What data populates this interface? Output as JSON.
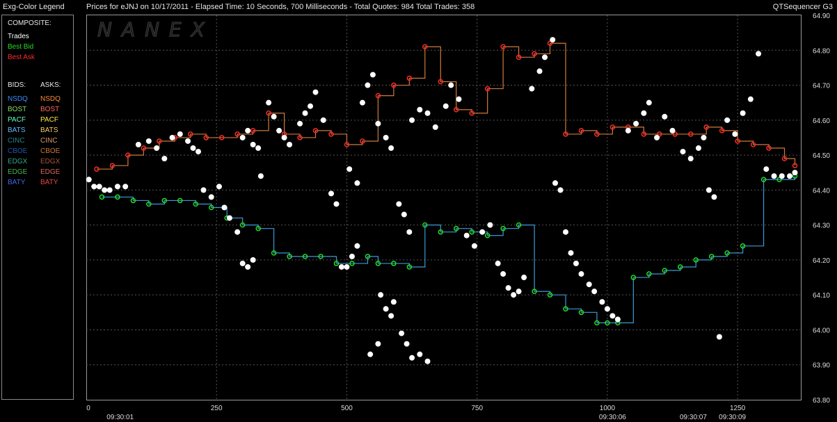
{
  "header": {
    "legend_title": "Exg-Color Legend",
    "chart_title": "Prices for  eJNJ  on  10/17/2011  -  Elapsed Time: 10 Seconds, 700 Milliseconds  -  Total Quotes: 984  Total Trades: 358",
    "app_name": "QTSequencer G3"
  },
  "watermark": "NANEX",
  "legend": {
    "composite_label": "COMPOSITE:",
    "composite_items": [
      {
        "label": "Trades",
        "color": "#ffffff"
      },
      {
        "label": "Best Bid",
        "color": "#22dd22"
      },
      {
        "label": "Best Ask",
        "color": "#ff2a2a"
      }
    ],
    "bids_label": "BIDS:",
    "asks_label": "ASKS:",
    "exchanges": [
      {
        "bid": "NSDQ",
        "ask": "NSDQ",
        "bid_color": "#3a8cff",
        "ask_color": "#ff8a3a"
      },
      {
        "bid": "BOST",
        "ask": "BOST",
        "bid_color": "#88dd66",
        "ask_color": "#ff6a5a"
      },
      {
        "bid": "PACF",
        "ask": "PACF",
        "bid_color": "#66ffcc",
        "ask_color": "#ffee44"
      },
      {
        "bid": "BATS",
        "ask": "BATS",
        "bid_color": "#66bbff",
        "ask_color": "#ffcc66"
      },
      {
        "bid": "CINC",
        "ask": "CINC",
        "bid_color": "#228888",
        "ask_color": "#dd9966"
      },
      {
        "bid": "CBOE",
        "ask": "CBOE",
        "bid_color": "#2255aa",
        "ask_color": "#cc7733"
      },
      {
        "bid": "EDGX",
        "ask": "EDGX",
        "bid_color": "#33aa88",
        "ask_color": "#aa5533"
      },
      {
        "bid": "EDGE",
        "ask": "EDGE",
        "bid_color": "#44bb44",
        "ask_color": "#dd6655"
      },
      {
        "bid": "BATY",
        "ask": "BATY",
        "bid_color": "#4466ee",
        "ask_color": "#ee4444"
      }
    ]
  },
  "chart_data": {
    "type": "scatter",
    "title": "Prices for eJNJ on 10/17/2011",
    "xlim": [
      0,
      1370
    ],
    "ylim": [
      63.8,
      64.9
    ],
    "x_ticks": [
      0,
      250,
      500,
      750,
      1000,
      1250
    ],
    "y_ticks": [
      63.8,
      63.9,
      64.0,
      64.1,
      64.2,
      64.3,
      64.4,
      64.5,
      64.6,
      64.7,
      64.8,
      64.9
    ],
    "time_labels": [
      {
        "x": 65,
        "label": "09:30:01"
      },
      {
        "x": 1010,
        "label": "09:30:06"
      },
      {
        "x": 1165,
        "label": "09:30:07"
      },
      {
        "x": 1240,
        "label": "09:30:09"
      }
    ],
    "grid": true,
    "series": [
      {
        "name": "Trades",
        "color": "#ffffff",
        "points": [
          [
            5,
            64.43
          ],
          [
            15,
            64.41
          ],
          [
            25,
            64.41
          ],
          [
            35,
            64.4
          ],
          [
            45,
            64.4
          ],
          [
            60,
            64.41
          ],
          [
            75,
            64.41
          ],
          [
            100,
            64.53
          ],
          [
            120,
            64.54
          ],
          [
            135,
            64.52
          ],
          [
            150,
            64.49
          ],
          [
            165,
            64.55
          ],
          [
            180,
            64.56
          ],
          [
            195,
            64.54
          ],
          [
            205,
            64.52
          ],
          [
            215,
            64.51
          ],
          [
            225,
            64.4
          ],
          [
            240,
            64.38
          ],
          [
            255,
            64.41
          ],
          [
            265,
            64.35
          ],
          [
            275,
            64.32
          ],
          [
            290,
            64.28
          ],
          [
            300,
            64.55
          ],
          [
            310,
            64.57
          ],
          [
            320,
            64.53
          ],
          [
            330,
            64.52
          ],
          [
            300,
            64.19
          ],
          [
            310,
            64.18
          ],
          [
            320,
            64.2
          ],
          [
            335,
            64.44
          ],
          [
            350,
            64.65
          ],
          [
            360,
            64.61
          ],
          [
            370,
            64.57
          ],
          [
            380,
            64.55
          ],
          [
            390,
            64.53
          ],
          [
            410,
            64.59
          ],
          [
            420,
            64.62
          ],
          [
            430,
            64.64
          ],
          [
            440,
            64.68
          ],
          [
            455,
            64.6
          ],
          [
            470,
            64.39
          ],
          [
            480,
            64.36
          ],
          [
            490,
            64.18
          ],
          [
            500,
            64.18
          ],
          [
            510,
            64.21
          ],
          [
            520,
            64.24
          ],
          [
            505,
            64.46
          ],
          [
            520,
            64.42
          ],
          [
            530,
            64.65
          ],
          [
            540,
            64.7
          ],
          [
            550,
            64.73
          ],
          [
            560,
            64.59
          ],
          [
            575,
            64.55
          ],
          [
            585,
            64.52
          ],
          [
            600,
            64.36
          ],
          [
            610,
            64.33
          ],
          [
            620,
            64.28
          ],
          [
            565,
            64.1
          ],
          [
            575,
            64.06
          ],
          [
            585,
            64.04
          ],
          [
            605,
            63.99
          ],
          [
            615,
            63.96
          ],
          [
            625,
            63.92
          ],
          [
            640,
            63.93
          ],
          [
            655,
            63.91
          ],
          [
            545,
            63.93
          ],
          [
            560,
            63.96
          ],
          [
            590,
            64.08
          ],
          [
            625,
            64.6
          ],
          [
            640,
            64.63
          ],
          [
            655,
            64.62
          ],
          [
            670,
            64.58
          ],
          [
            690,
            64.64
          ],
          [
            700,
            64.7
          ],
          [
            715,
            64.66
          ],
          [
            730,
            64.27
          ],
          [
            745,
            64.24
          ],
          [
            760,
            64.28
          ],
          [
            775,
            64.3
          ],
          [
            790,
            64.19
          ],
          [
            800,
            64.16
          ],
          [
            810,
            64.12
          ],
          [
            820,
            64.1
          ],
          [
            830,
            64.11
          ],
          [
            840,
            64.15
          ],
          [
            855,
            64.69
          ],
          [
            870,
            64.74
          ],
          [
            880,
            64.78
          ],
          [
            895,
            64.83
          ],
          [
            900,
            64.42
          ],
          [
            910,
            64.4
          ],
          [
            920,
            64.28
          ],
          [
            930,
            64.22
          ],
          [
            940,
            64.19
          ],
          [
            950,
            64.16
          ],
          [
            965,
            64.13
          ],
          [
            975,
            64.11
          ],
          [
            990,
            64.08
          ],
          [
            1000,
            64.06
          ],
          [
            1010,
            64.04
          ],
          [
            1020,
            64.03
          ],
          [
            1040,
            64.57
          ],
          [
            1055,
            64.59
          ],
          [
            1070,
            64.62
          ],
          [
            1080,
            64.65
          ],
          [
            1095,
            64.55
          ],
          [
            1110,
            64.61
          ],
          [
            1125,
            64.57
          ],
          [
            1145,
            64.51
          ],
          [
            1160,
            64.49
          ],
          [
            1175,
            64.52
          ],
          [
            1185,
            64.55
          ],
          [
            1195,
            64.4
          ],
          [
            1205,
            64.38
          ],
          [
            1215,
            63.98
          ],
          [
            1230,
            64.6
          ],
          [
            1245,
            64.56
          ],
          [
            1260,
            64.62
          ],
          [
            1275,
            64.66
          ],
          [
            1290,
            64.79
          ],
          [
            1305,
            64.46
          ],
          [
            1320,
            64.44
          ],
          [
            1335,
            64.44
          ],
          [
            1350,
            64.44
          ],
          [
            1360,
            64.45
          ]
        ]
      },
      {
        "name": "Best Bid",
        "color": "#22dd22",
        "points": [
          [
            30,
            64.38
          ],
          [
            60,
            64.38
          ],
          [
            90,
            64.37
          ],
          [
            120,
            64.36
          ],
          [
            150,
            64.37
          ],
          [
            180,
            64.37
          ],
          [
            210,
            64.36
          ],
          [
            240,
            64.35
          ],
          [
            270,
            64.32
          ],
          [
            300,
            64.3
          ],
          [
            330,
            64.29
          ],
          [
            360,
            64.22
          ],
          [
            390,
            64.21
          ],
          [
            420,
            64.21
          ],
          [
            450,
            64.21
          ],
          [
            480,
            64.19
          ],
          [
            510,
            64.19
          ],
          [
            540,
            64.21
          ],
          [
            560,
            64.19
          ],
          [
            590,
            64.19
          ],
          [
            620,
            64.18
          ],
          [
            650,
            64.3
          ],
          [
            680,
            64.28
          ],
          [
            710,
            64.29
          ],
          [
            740,
            64.28
          ],
          [
            770,
            64.27
          ],
          [
            800,
            64.29
          ],
          [
            830,
            64.3
          ],
          [
            860,
            64.11
          ],
          [
            890,
            64.1
          ],
          [
            920,
            64.06
          ],
          [
            950,
            64.05
          ],
          [
            980,
            64.02
          ],
          [
            1000,
            64.02
          ],
          [
            1020,
            64.02
          ],
          [
            1050,
            64.15
          ],
          [
            1080,
            64.16
          ],
          [
            1110,
            64.17
          ],
          [
            1140,
            64.18
          ],
          [
            1170,
            64.2
          ],
          [
            1200,
            64.21
          ],
          [
            1230,
            64.22
          ],
          [
            1260,
            64.24
          ],
          [
            1300,
            64.43
          ],
          [
            1330,
            64.43
          ],
          [
            1360,
            64.44
          ]
        ]
      },
      {
        "name": "Best Ask",
        "color": "#ff2a2a",
        "points": [
          [
            20,
            64.46
          ],
          [
            50,
            64.47
          ],
          [
            80,
            64.5
          ],
          [
            110,
            64.52
          ],
          [
            140,
            64.54
          ],
          [
            170,
            64.55
          ],
          [
            200,
            64.56
          ],
          [
            230,
            64.55
          ],
          [
            260,
            64.55
          ],
          [
            290,
            64.56
          ],
          [
            320,
            64.57
          ],
          [
            350,
            64.62
          ],
          [
            380,
            64.56
          ],
          [
            410,
            64.55
          ],
          [
            440,
            64.57
          ],
          [
            470,
            64.56
          ],
          [
            500,
            64.53
          ],
          [
            530,
            64.54
          ],
          [
            560,
            64.67
          ],
          [
            590,
            64.7
          ],
          [
            620,
            64.72
          ],
          [
            650,
            64.81
          ],
          [
            680,
            64.71
          ],
          [
            710,
            64.63
          ],
          [
            740,
            64.62
          ],
          [
            770,
            64.69
          ],
          [
            800,
            64.81
          ],
          [
            830,
            64.78
          ],
          [
            860,
            64.79
          ],
          [
            890,
            64.82
          ],
          [
            920,
            64.56
          ],
          [
            950,
            64.57
          ],
          [
            980,
            64.56
          ],
          [
            1010,
            64.58
          ],
          [
            1040,
            64.58
          ],
          [
            1070,
            64.56
          ],
          [
            1100,
            64.56
          ],
          [
            1130,
            64.56
          ],
          [
            1160,
            64.56
          ],
          [
            1190,
            64.58
          ],
          [
            1220,
            64.57
          ],
          [
            1250,
            64.54
          ],
          [
            1280,
            64.53
          ],
          [
            1310,
            64.52
          ],
          [
            1340,
            64.49
          ],
          [
            1360,
            64.47
          ]
        ]
      }
    ]
  }
}
